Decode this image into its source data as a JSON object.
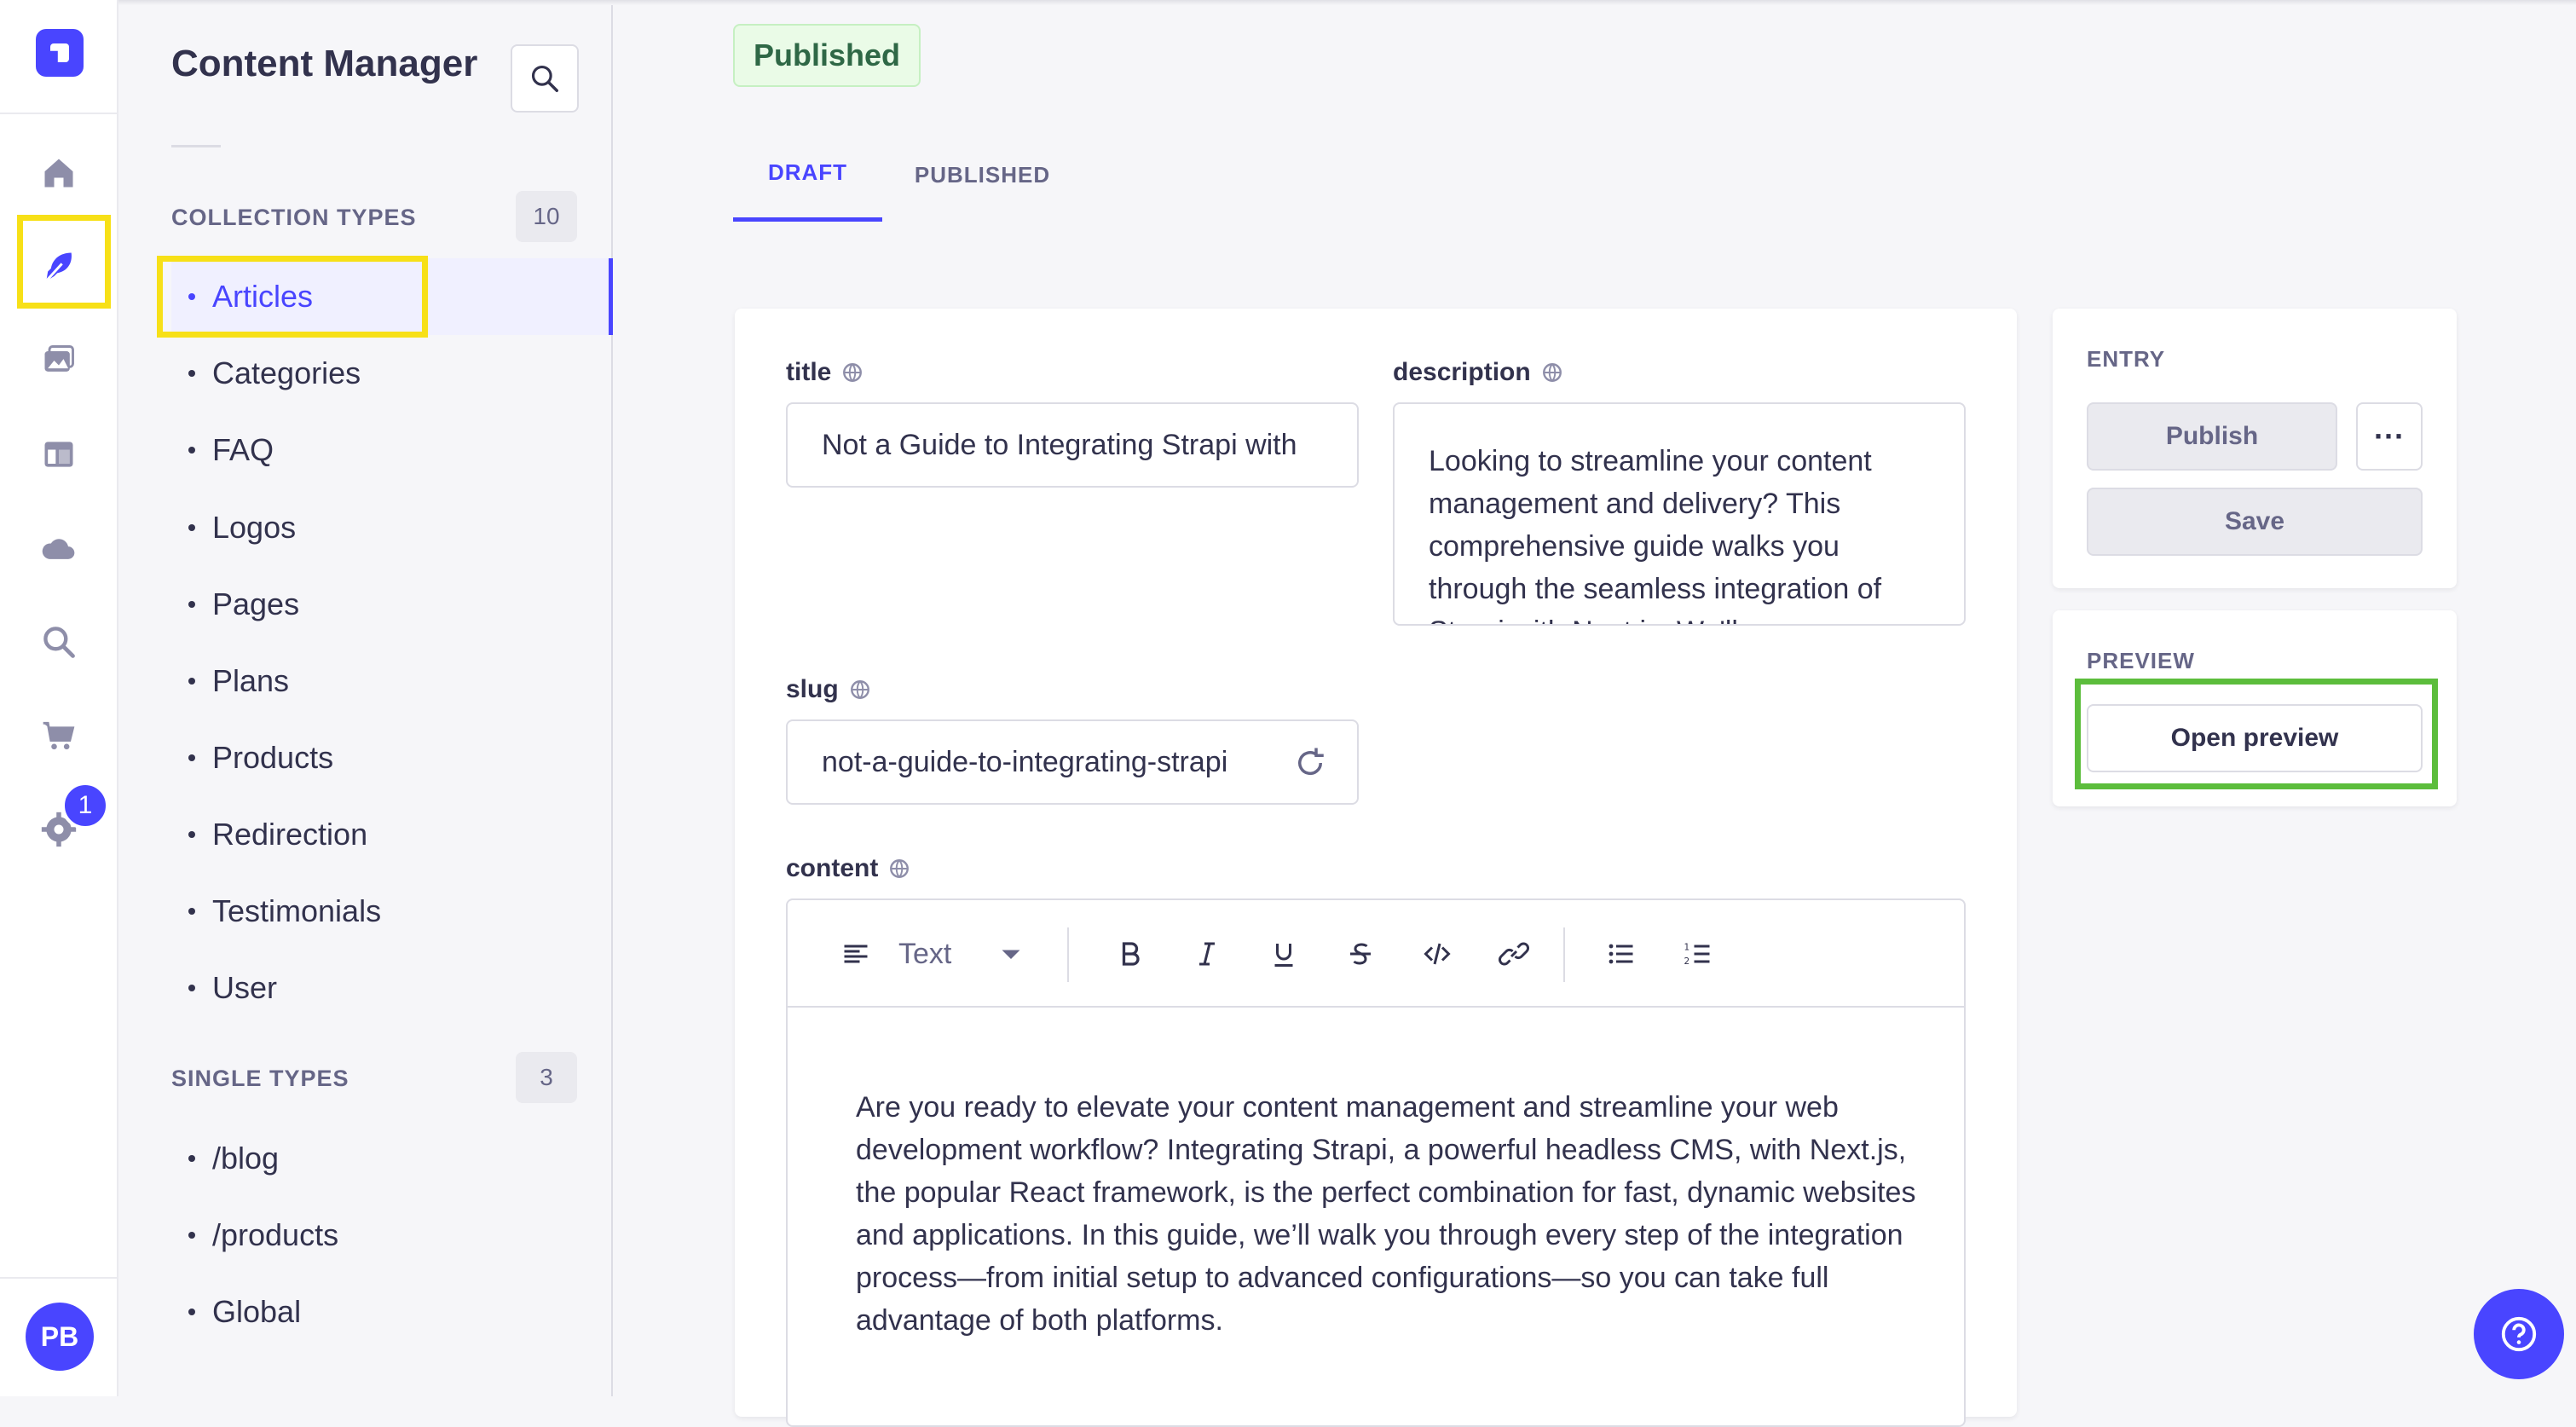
{
  "app": {
    "section_title": "Content Manager"
  },
  "rail": {
    "icons": [
      "strapi-logo-icon",
      "home-icon",
      "content-manager-feather-icon",
      "media-library-icon",
      "content-type-builder-icon",
      "cloud-icon",
      "search-icon",
      "marketplace-cart-icon",
      "settings-gear-icon"
    ],
    "settings_badge": "1",
    "user_initials": "PB"
  },
  "sidebar": {
    "collection_types_label": "COLLECTION TYPES",
    "collection_types_count": "10",
    "collection_types": [
      "Articles",
      "Categories",
      "FAQ",
      "Logos",
      "Pages",
      "Plans",
      "Products",
      "Redirection",
      "Testimonials",
      "User"
    ],
    "single_types_label": "SINGLE TYPES",
    "single_types_count": "3",
    "single_types": [
      "/blog",
      "/products",
      "Global"
    ]
  },
  "entry": {
    "status_badge": "Published",
    "tabs": [
      "DRAFT",
      "PUBLISHED"
    ],
    "active_tab": "DRAFT",
    "fields": {
      "title_label": "title",
      "title_value": "Not a Guide to Integrating Strapi with",
      "description_label": "description",
      "description_value": "Looking to streamline your content management and delivery? This comprehensive guide walks you through the seamless integration of Strapi with Next.js. We'll",
      "slug_label": "slug",
      "slug_value": "not-a-guide-to-integrating-strapi",
      "content_label": "content",
      "content_value": "Are you ready to elevate your content management and streamline your web development workflow? Integrating Strapi, a powerful headless CMS, with Next.js, the popular React framework, is the perfect combination for fast, dynamic websites and applications. In this guide, we’ll walk you through every step of the integration process—from initial setup to advanced configurations—so you can take full advantage of both platforms."
    },
    "editor_toolbar": {
      "block_type": "Text",
      "buttons": [
        "bold-icon",
        "italic-icon",
        "underline-icon",
        "strikethrough-icon",
        "code-icon",
        "link-icon",
        "bullet-list-icon",
        "numbered-list-icon"
      ]
    }
  },
  "right_panel": {
    "entry_label": "ENTRY",
    "publish_button": "Publish",
    "more_button": "···",
    "save_button": "Save",
    "preview_label": "PREVIEW",
    "open_preview_button": "Open preview"
  },
  "colors": {
    "primary": "#4945ff",
    "highlight_yellow": "#f7e017",
    "highlight_green": "#5cbd3c",
    "success_bg": "#eafbe7",
    "success_text": "#2f6846"
  }
}
